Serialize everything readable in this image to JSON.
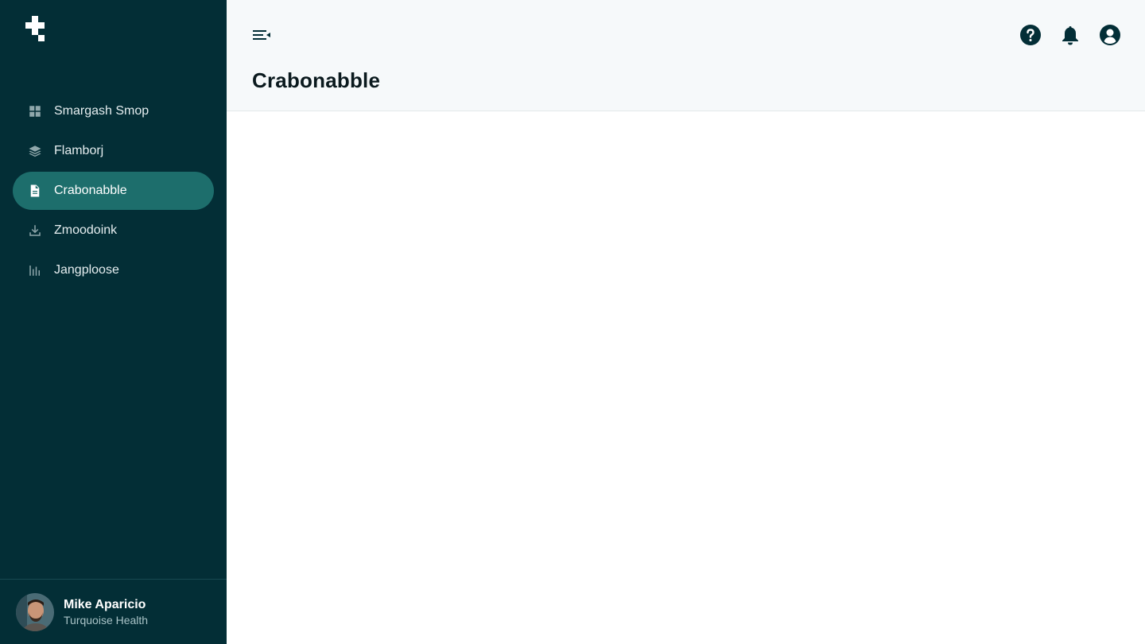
{
  "sidebar": {
    "logo_icon": "plus-cross-logo",
    "items": [
      {
        "label": "Smargash Smop",
        "icon": "grid-icon",
        "active": false
      },
      {
        "label": "Flamborj",
        "icon": "layers-icon",
        "active": false
      },
      {
        "label": "Crabonabble",
        "icon": "document-icon",
        "active": true
      },
      {
        "label": "Zmoodoink",
        "icon": "download-icon",
        "active": false
      },
      {
        "label": "Jangploose",
        "icon": "bar-chart-icon",
        "active": false
      }
    ],
    "user": {
      "name": "Mike Aparicio",
      "org": "Turquoise Health"
    }
  },
  "header": {
    "title": "Crabonabble",
    "icons": [
      "help-icon",
      "bell-icon",
      "account-icon"
    ]
  },
  "colors": {
    "sidebar_bg": "#032e36",
    "active_item_bg": "#1d6e6c",
    "header_bg": "#f6f9fa",
    "icon_dark": "#032e36"
  }
}
